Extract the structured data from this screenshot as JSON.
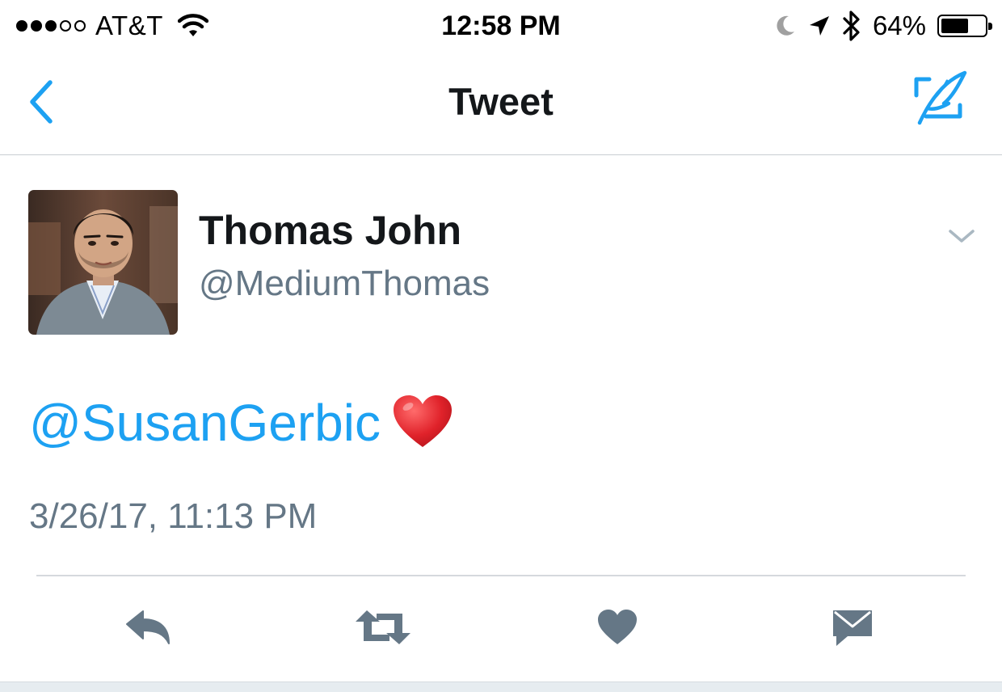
{
  "status_bar": {
    "signal": {
      "filled": 3,
      "total": 5
    },
    "carrier": "AT&T",
    "time": "12:58 PM",
    "battery_percent": "64%",
    "battery_level": 0.64,
    "icons": [
      "signal-dots-icon",
      "wifi-icon",
      "moon-icon",
      "location-arrow-icon",
      "bluetooth-icon",
      "battery-icon"
    ]
  },
  "nav": {
    "title": "Tweet",
    "back_icon": "chevron-left-icon",
    "compose_icon": "compose-tweet-icon"
  },
  "tweet": {
    "author_name": "Thomas John",
    "author_handle": "@MediumThomas",
    "mention": "@SusanGerbic",
    "emoji": "red-heart",
    "timestamp": "3/26/17, 11:13 PM",
    "menu_icon": "chevron-down-icon"
  },
  "actions": [
    {
      "name": "reply",
      "icon": "reply-icon"
    },
    {
      "name": "retweet",
      "icon": "retweet-icon"
    },
    {
      "name": "like",
      "icon": "heart-icon"
    },
    {
      "name": "direct-message",
      "icon": "envelope-icon"
    }
  ],
  "colors": {
    "accent": "#1da1f2",
    "text_primary": "#14171a",
    "text_secondary": "#657786",
    "icon_gray": "#657786",
    "heart_red": "#e0222a"
  }
}
